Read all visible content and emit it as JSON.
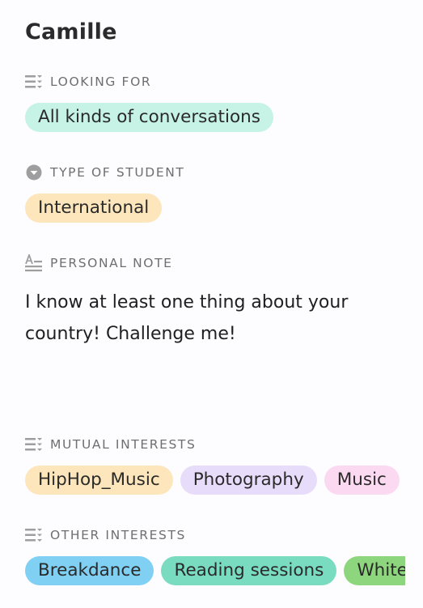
{
  "profile": {
    "name": "Camille"
  },
  "fields": {
    "looking_for": {
      "label": "LOOKING FOR",
      "icon": "multi-select-icon",
      "tags": [
        {
          "label": "All kinds of conversations",
          "color": "#c6f3e6"
        }
      ]
    },
    "student_type": {
      "label": "TYPE OF STUDENT",
      "icon": "single-select-icon",
      "tags": [
        {
          "label": "International",
          "color": "#fde6bb"
        }
      ]
    },
    "personal_note": {
      "label": "PERSONAL NOTE",
      "icon": "long-text-icon",
      "text": "I know at least one thing about your country! Challenge me!"
    },
    "mutual_interests": {
      "label": "MUTUAL INTERESTS",
      "icon": "multi-select-icon",
      "tags": [
        {
          "label": "HipHop_Music",
          "color": "#fde6bb"
        },
        {
          "label": "Photography",
          "color": "#e8dcfb"
        },
        {
          "label": "Music",
          "color": "#fbdaf1"
        }
      ]
    },
    "other_interests": {
      "label": "OTHER INTERESTS",
      "icon": "multi-select-icon",
      "tags": [
        {
          "label": "Breakdance",
          "color": "#7fd0f3"
        },
        {
          "label": "Reading sessions",
          "color": "#79dcc1"
        },
        {
          "label": "White",
          "color": "#8ed67e"
        }
      ]
    }
  }
}
